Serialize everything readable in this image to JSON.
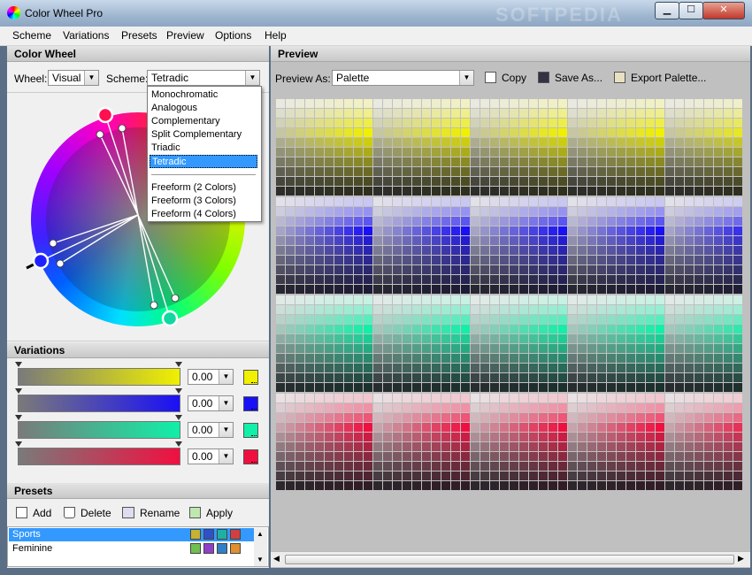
{
  "window": {
    "title": "Color Wheel Pro"
  },
  "menu": [
    "Scheme",
    "Variations",
    "Presets",
    "Preview",
    "Options",
    "Help"
  ],
  "watermark": "SOFTPEDIA",
  "color_wheel": {
    "header": "Color Wheel",
    "wheel_label": "Wheel:",
    "wheel_value": "Visual",
    "scheme_label": "Scheme:",
    "scheme_value": "Tetradic",
    "scheme_options": [
      "Monochromatic",
      "Analogous",
      "Complementary",
      "Split Complementary",
      "Triadic",
      "Tetradic",
      "",
      "Freeform (2 Colors)",
      "Freeform (3 Colors)",
      "Freeform (4 Colors)"
    ],
    "selected_option": "Tetradic"
  },
  "preview": {
    "header": "Preview",
    "preview_as_label": "Preview As:",
    "preview_as_value": "Palette",
    "copy": "Copy",
    "save_as": "Save As...",
    "export": "Export Palette..."
  },
  "variations": {
    "header": "Variations",
    "rows": [
      {
        "value": "0.00",
        "color": "#f0f000"
      },
      {
        "value": "0.00",
        "color": "#1a10f5"
      },
      {
        "value": "0.00",
        "color": "#10f0a8"
      },
      {
        "value": "0.00",
        "color": "#f01040"
      }
    ]
  },
  "presets": {
    "header": "Presets",
    "add": "Add",
    "delete": "Delete",
    "rename": "Rename",
    "apply": "Apply",
    "items": [
      {
        "name": "Sports",
        "selected": true,
        "colors": [
          "#c8b030",
          "#3050c8",
          "#20b0a0",
          "#d04040"
        ]
      },
      {
        "name": "Feminine",
        "selected": false,
        "colors": [
          "#70c050",
          "#9040c8",
          "#3080c8",
          "#e09030"
        ]
      }
    ]
  },
  "palette": {
    "hues": [
      "#f0f000",
      "#1a10f5",
      "#10f0a8",
      "#f01040"
    ]
  }
}
